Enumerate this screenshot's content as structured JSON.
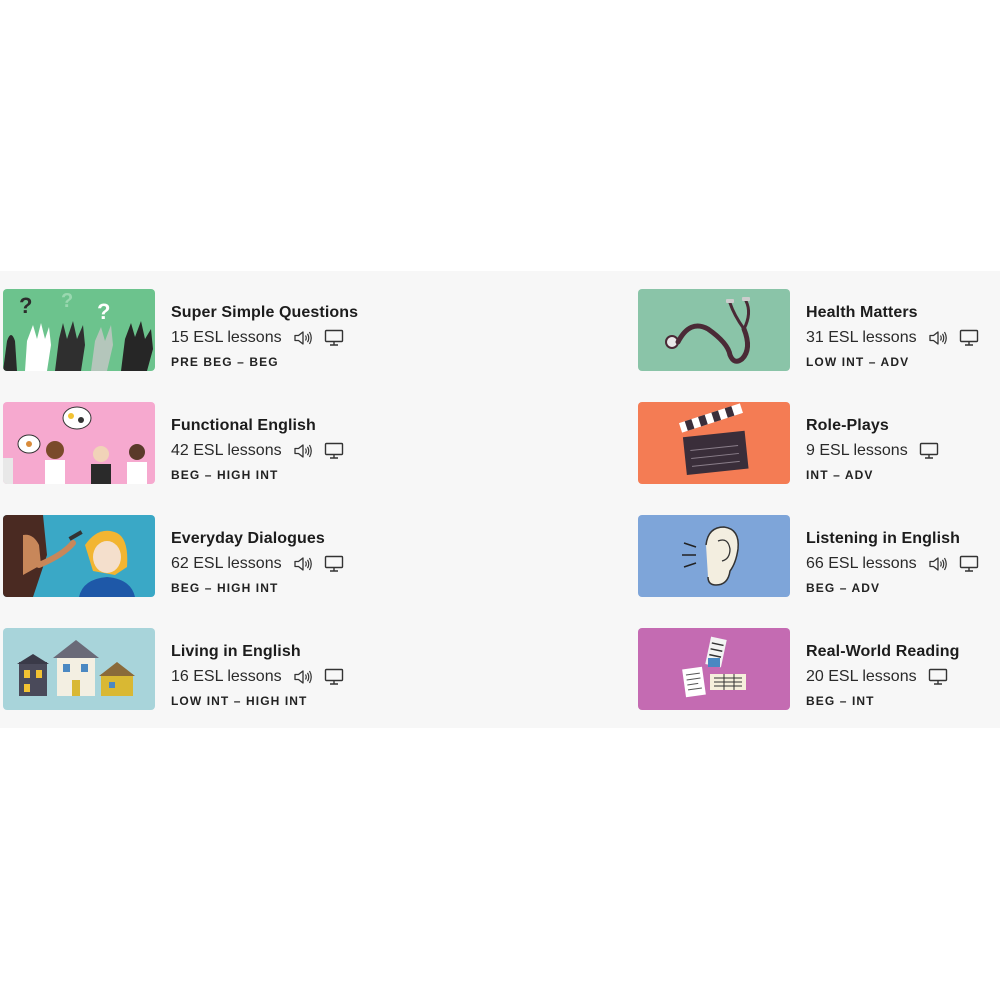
{
  "courses": [
    {
      "title": "Super Simple Questions",
      "count": "15 ESL lessons",
      "level": "PRE BEG – BEG",
      "thumb_color": "#6cc38d",
      "icons": [
        "speaker-icon",
        "monitor-icon"
      ]
    },
    {
      "title": "Health Matters",
      "count": "31 ESL lessons",
      "level": "LOW INT – ADV",
      "thumb_color": "#8ac4a8",
      "icons": [
        "speaker-icon",
        "monitor-icon"
      ]
    },
    {
      "title": "Functional English",
      "count": "42 ESL lessons",
      "level": "BEG – HIGH INT",
      "thumb_color": "#f6a9cf",
      "icons": [
        "speaker-icon",
        "monitor-icon"
      ]
    },
    {
      "title": "Role-Plays",
      "count": "9 ESL lessons",
      "level": "INT – ADV",
      "thumb_color": "#f47c54",
      "icons": [
        "monitor-icon"
      ]
    },
    {
      "title": "Everyday Dialogues",
      "count": "62 ESL lessons",
      "level": "BEG – HIGH INT",
      "thumb_color": "#3aa8c6",
      "icons": [
        "speaker-icon",
        "monitor-icon"
      ]
    },
    {
      "title": "Listening in English",
      "count": "66 ESL lessons",
      "level": "BEG – ADV",
      "thumb_color": "#7ea5d9",
      "icons": [
        "speaker-icon",
        "monitor-icon"
      ]
    },
    {
      "title": "Living in English",
      "count": "16 ESL lessons",
      "level": "LOW INT – HIGH INT",
      "thumb_color": "#a8d4da",
      "icons": [
        "speaker-icon",
        "monitor-icon"
      ]
    },
    {
      "title": "Real-World Reading",
      "count": "20 ESL lessons",
      "level": "BEG – INT",
      "thumb_color": "#c46bb2",
      "icons": [
        "monitor-icon"
      ]
    }
  ]
}
